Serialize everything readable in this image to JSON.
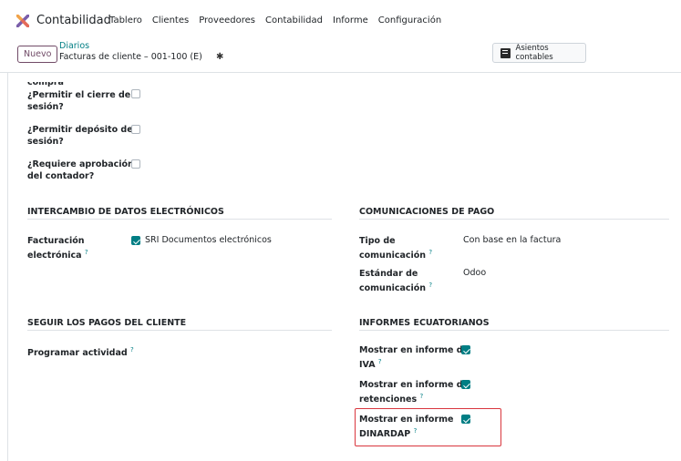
{
  "app": {
    "name": "Contabilidad"
  },
  "menu": {
    "items": [
      "Tablero",
      "Clientes",
      "Proveedores",
      "Contabilidad",
      "Informe",
      "Configuración"
    ]
  },
  "control": {
    "new_label": "Nuevo",
    "breadcrumb_parent": "Diarios",
    "breadcrumb_current": "Facturas de cliente – 001-100 (E)",
    "asientos_label": "Asientos contables"
  },
  "top_fields": {
    "truncated_label": "compra",
    "cierre_sesion": {
      "label_line1": "¿Permitir el cierre de",
      "label_line2": "sesión?",
      "checked": false
    },
    "deposito_sesion": {
      "label_line1": "¿Permitir depósito de",
      "label_line2": "sesión?",
      "checked": false
    },
    "aprobacion": {
      "label_line1": "¿Requiere aprobación",
      "label_line2": "del contador?",
      "checked": false
    }
  },
  "sections": {
    "edi": {
      "title": "INTERCAMBIO DE DATOS ELECTRÓNICOS",
      "facturacion_line1": "Facturación",
      "facturacion_line2": "electrónica",
      "sri_label": "SRI Documentos electrónicos",
      "sri_checked": true
    },
    "comunicaciones": {
      "title": "COMUNICACIONES DE PAGO",
      "tipo_line1": "Tipo de",
      "tipo_line2": "comunicación",
      "tipo_value": "Con base en la factura",
      "estandar_line1": "Estándar de",
      "estandar_line2": "comunicación",
      "estandar_value": "Odoo"
    },
    "seguir": {
      "title": "SEGUIR LOS PAGOS DEL CLIENTE",
      "programar_label": "Programar actividad"
    },
    "informes": {
      "title": "INFORMES ECUATORIANOS",
      "iva_line1": "Mostrar en informe de",
      "iva_line2": "IVA",
      "iva_checked": true,
      "ret_line1": "Mostrar en informe de",
      "ret_line2": "retenciones",
      "ret_checked": true,
      "dinardap_line1": "Mostrar en informe",
      "dinardap_line2": "DINARDAP",
      "dinardap_checked": true
    }
  },
  "help_mark": "?"
}
